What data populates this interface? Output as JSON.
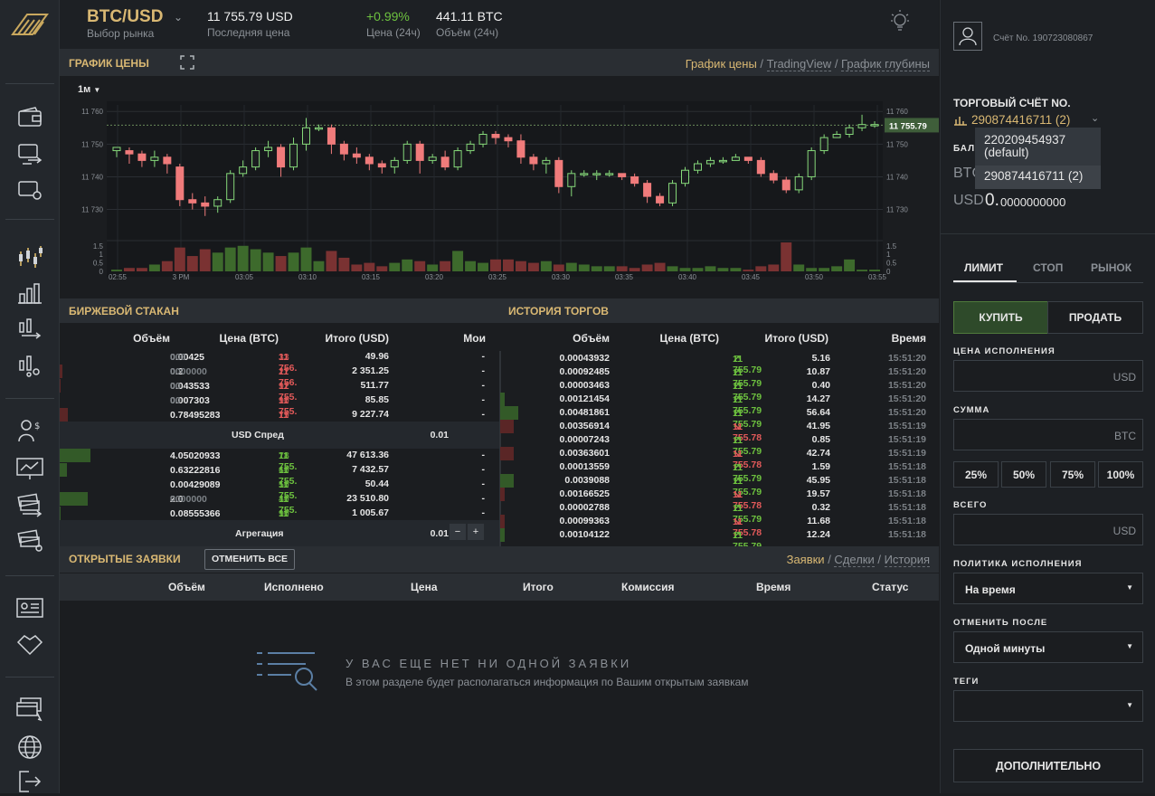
{
  "market": {
    "pair": "BTC/USD",
    "pair_sub": "Выбор рынка",
    "last_price": "11 755.79 USD",
    "last_price_sub": "Последняя цена",
    "change": "+0.99%",
    "change_sub": "Цена (24ч)",
    "volume": "441.11 BTC",
    "volume_sub": "Объём (24ч)"
  },
  "chart_panel": {
    "title": "ГРАФИК ЦЕНЫ",
    "tab_active": "График цены",
    "tab2": "TradingView",
    "tab3": "График глубины",
    "interval": "1м",
    "current_price_tag": "11 755.79",
    "y_ticks": [
      "11 760",
      "11 750",
      "11 740",
      "11 730"
    ],
    "vol_ticks": [
      "1.5",
      "1",
      "0.5",
      "0"
    ],
    "x_ticks": [
      "02:55",
      "3 PM",
      "03:05",
      "03:10",
      "03:15",
      "03:20",
      "03:25",
      "03:30",
      "03:35",
      "03:40",
      "03:45",
      "03:50",
      "03:55"
    ]
  },
  "chart_data": {
    "type": "candlestick",
    "ylim": [
      11726,
      11762
    ],
    "candles": [
      [
        11748,
        11749,
        11746,
        11748
      ],
      [
        11748,
        11747,
        11744,
        11749
      ],
      [
        11747,
        11745,
        11743,
        11748
      ],
      [
        11745,
        11746,
        11743,
        11748
      ],
      [
        11746,
        11744,
        11741,
        11747
      ],
      [
        11743,
        11733,
        11731,
        11744
      ],
      [
        11733,
        11732,
        11730,
        11735
      ],
      [
        11732,
        11731,
        11728,
        11734
      ],
      [
        11731,
        11733,
        11729,
        11734
      ],
      [
        11733,
        11741,
        11732,
        11742
      ],
      [
        11741,
        11743,
        11740,
        11745
      ],
      [
        11743,
        11748,
        11742,
        11749
      ],
      [
        11748,
        11749,
        11746,
        11751
      ],
      [
        11749,
        11743,
        11740,
        11750
      ],
      [
        11743,
        11750,
        11742,
        11752
      ],
      [
        11750,
        11755,
        11748,
        11758
      ],
      [
        11755,
        11755,
        11754,
        11756
      ],
      [
        11755,
        11750,
        11747,
        11756
      ],
      [
        11750,
        11747,
        11745,
        11751
      ],
      [
        11747,
        11746,
        11744,
        11749
      ],
      [
        11746,
        11744,
        11742,
        11747
      ],
      [
        11744,
        11743,
        11741,
        11745
      ],
      [
        11743,
        11745,
        11741,
        11746
      ],
      [
        11745,
        11750,
        11744,
        11751
      ],
      [
        11750,
        11745,
        11741,
        11751
      ],
      [
        11745,
        11746,
        11744,
        11747
      ],
      [
        11746,
        11743,
        11742,
        11748
      ],
      [
        11743,
        11748,
        11742,
        11749
      ],
      [
        11748,
        11750,
        11747,
        11751
      ],
      [
        11750,
        11753,
        11749,
        11754
      ],
      [
        11753,
        11752,
        11750,
        11754
      ],
      [
        11752,
        11751,
        11749,
        11753
      ],
      [
        11751,
        11746,
        11744,
        11753
      ],
      [
        11746,
        11744,
        11742,
        11747
      ],
      [
        11744,
        11745,
        11741,
        11746
      ],
      [
        11745,
        11737,
        11735,
        11746
      ],
      [
        11737,
        11741,
        11734,
        11742
      ],
      [
        11741,
        11741,
        11740,
        11742
      ],
      [
        11741,
        11741,
        11739,
        11742
      ],
      [
        11741,
        11741,
        11740,
        11742
      ],
      [
        11741,
        11740,
        11739,
        11741
      ],
      [
        11740,
        11738,
        11737,
        11741
      ],
      [
        11738,
        11734,
        11732,
        11739
      ],
      [
        11734,
        11732,
        11731,
        11735
      ],
      [
        11732,
        11738,
        11731,
        11739
      ],
      [
        11738,
        11742,
        11737,
        11743
      ],
      [
        11742,
        11744,
        11741,
        11745
      ],
      [
        11744,
        11745,
        11743,
        11746
      ],
      [
        11745,
        11745,
        11744,
        11746
      ],
      [
        11745,
        11746,
        11745,
        11747
      ],
      [
        11746,
        11745,
        11744,
        11746
      ],
      [
        11745,
        11741,
        11740,
        11746
      ],
      [
        11741,
        11739,
        11738,
        11742
      ],
      [
        11739,
        11736,
        11735,
        11740
      ],
      [
        11736,
        11740,
        11735,
        11741
      ],
      [
        11740,
        11748,
        11739,
        11749
      ],
      [
        11748,
        11752,
        11747,
        11753
      ],
      [
        11752,
        11753,
        11752,
        11754
      ],
      [
        11753,
        11755,
        11752,
        11756
      ],
      [
        11755,
        11756,
        11754,
        11759
      ],
      [
        11756,
        11756,
        11755,
        11757
      ]
    ],
    "volumes": [
      0.1,
      0.2,
      0.2,
      0.4,
      0.6,
      1.4,
      0.9,
      1.3,
      1.1,
      1.4,
      1.5,
      1.3,
      1.1,
      0.9,
      1.1,
      1.4,
      0.6,
      1.2,
      0.8,
      0.4,
      0.5,
      0.3,
      0.5,
      0.7,
      0.6,
      0.4,
      0.6,
      1.2,
      0.6,
      0.5,
      0.7,
      0.7,
      0.6,
      0.5,
      0.6,
      0.4,
      0.5,
      0.4,
      0.3,
      0.3,
      0.3,
      0.2,
      0.4,
      0.5,
      0.3,
      0.2,
      0.2,
      0.3,
      0.2,
      0.2,
      0.1,
      0.3,
      0.4,
      1.7,
      0.4,
      0.2,
      0.2,
      0.3,
      0.7,
      0.1,
      0.1
    ],
    "vol_ylim": [
      0,
      1.7
    ]
  },
  "orderbook": {
    "title": "БИРЖЕВОЙ СТАКАН",
    "cols": [
      "Объём",
      "Цена (BTC)",
      "Итого (USD)",
      "Мои"
    ],
    "asks": [
      {
        "vol": "0.00425",
        "vol_dim": "000",
        "price": "11 756.",
        "price_dim": "33",
        "total": "49.96",
        "mine": "-",
        "depth": 0.0
      },
      {
        "vol": "0.2",
        "vol_dim": "0000000",
        "price": "11 756.",
        "price_dim": "27",
        "total": "2 351.25",
        "mine": "-",
        "depth": 0.02
      },
      {
        "vol": "0.043533",
        "vol_dim": "00",
        "price": "11 755.",
        "price_dim": "92",
        "total": "511.77",
        "mine": "-",
        "depth": 0.01
      },
      {
        "vol": "0.007303",
        "vol_dim": "00",
        "price": "11 755.",
        "price_dim": "90",
        "total": "85.85",
        "mine": "-",
        "depth": 0.0
      },
      {
        "vol": "0.78495283",
        "vol_dim": "",
        "price": "11 755.",
        "price_dim": "79",
        "total": "9 227.74",
        "mine": "-",
        "depth": 0.07
      }
    ],
    "spread_label": "USD Спред",
    "spread": "0.01",
    "bids": [
      {
        "vol": "4.05020933",
        "vol_dim": "",
        "price": "11 755.",
        "price_dim": "78",
        "total": "47 613.36",
        "mine": "-",
        "depth": 0.26
      },
      {
        "vol": "0.63222816",
        "vol_dim": "",
        "price": "11 755.",
        "price_dim": "60",
        "total": "7 432.57",
        "mine": "-",
        "depth": 0.06
      },
      {
        "vol": "0.00429089",
        "vol_dim": "",
        "price": "11 755.",
        "price_dim": "50",
        "total": "50.44",
        "mine": "-",
        "depth": 0.0
      },
      {
        "vol": "2.0",
        "vol_dim": "0000000",
        "price": "11 755.",
        "price_dim": "40",
        "total": "23 510.80",
        "mine": "-",
        "depth": 0.24
      },
      {
        "vol": "0.08555366",
        "vol_dim": "",
        "price": "11 754.",
        "price_dim": "90",
        "total": "1 005.67",
        "mine": "-",
        "depth": 0.01
      }
    ],
    "aggregation_label": "Агрегация",
    "aggregation": "0.01",
    "minus": "−",
    "plus": "+"
  },
  "trades": {
    "title": "ИСТОРИЯ ТОРГОВ",
    "cols": [
      "Объём",
      "Цена (BTC)",
      "Итого (USD)",
      "Время"
    ],
    "rows": [
      {
        "vol": "0.00043932",
        "price": "11 755.79",
        "dir": "up",
        "total": "5.16",
        "time": "15:51:20",
        "depth": 0.0
      },
      {
        "vol": "0.00092485",
        "price": "11 755.79",
        "dir": "up",
        "total": "10.87",
        "time": "15:51:20",
        "depth": 0.0
      },
      {
        "vol": "0.00003463",
        "price": "11 755.79",
        "dir": "up",
        "total": "0.40",
        "time": "15:51:20",
        "depth": 0.0
      },
      {
        "vol": "0.00121454",
        "price": "11 755.79",
        "dir": "up",
        "total": "14.27",
        "time": "15:51:20",
        "depth": 0.01
      },
      {
        "vol": "0.00481861",
        "price": "11 755.79",
        "dir": "up",
        "total": "56.64",
        "time": "15:51:20",
        "depth": 0.04
      },
      {
        "vol": "0.00356914",
        "price": "11 755.78",
        "dir": "down",
        "total": "41.95",
        "time": "15:51:19",
        "depth": 0.03
      },
      {
        "vol": "0.00007243",
        "price": "11 755.79",
        "dir": "up",
        "total": "0.85",
        "time": "15:51:19",
        "depth": 0.0
      },
      {
        "vol": "0.00363601",
        "price": "11 755.78",
        "dir": "down",
        "total": "42.74",
        "time": "15:51:19",
        "depth": 0.03
      },
      {
        "vol": "0.00013559",
        "price": "11 755.79",
        "dir": "up",
        "total": "1.59",
        "time": "15:51:18",
        "depth": 0.0
      },
      {
        "vol": "0.0039088",
        "price": "11 755.79",
        "dir": "up",
        "total": "45.95",
        "time": "15:51:18",
        "depth": 0.03
      },
      {
        "vol": "0.00166525",
        "price": "11 755.78",
        "dir": "down",
        "total": "19.57",
        "time": "15:51:18",
        "depth": 0.01
      },
      {
        "vol": "0.00002788",
        "price": "11 755.79",
        "dir": "up",
        "total": "0.32",
        "time": "15:51:18",
        "depth": 0.0
      },
      {
        "vol": "0.00099363",
        "price": "11 755.78",
        "dir": "down",
        "total": "11.68",
        "time": "15:51:18",
        "depth": 0.01
      },
      {
        "vol": "0.00104122",
        "price": "11 755.79",
        "dir": "up",
        "total": "12.24",
        "time": "15:51:18",
        "depth": 0.01
      }
    ]
  },
  "orders": {
    "title": "ОТКРЫТЫЕ ЗАЯВКИ",
    "cancel_all": "ОТМЕНИТЬ ВСЕ",
    "tab_active": "Заявки",
    "tab2": "Сделки",
    "tab3": "История",
    "cols": [
      "Объём",
      "Исполнено",
      "Цена",
      "Итого",
      "Комиссия",
      "Время",
      "Статус"
    ],
    "empty_title": "У ВАС ЕЩЕ НЕТ НИ ОДНОЙ ЗАЯВКИ",
    "empty_text": "В этом разделе будет располагаться информация по Вашим открытым заявкам"
  },
  "account": {
    "account_no": "Счёт No. 190723080867",
    "trading_title": "ТОРГОВЫЙ СЧЁТ NO.",
    "selected": "290874416711 (2)",
    "dropdown": [
      {
        "line1": "220209454937",
        "line2": "(default)"
      },
      {
        "line1": "290874416711 (2)",
        "line2": ""
      }
    ],
    "balance_label": "БАЛА",
    "btc_label": "BTC",
    "usd_label": "USD",
    "usd_balance_int": "0.",
    "usd_balance_dec": "0000000000"
  },
  "order_form": {
    "tab_limit": "ЛИМИТ",
    "tab_stop": "СТОП",
    "tab_market": "РЫНОК",
    "buy": "КУПИТЬ",
    "sell": "ПРОДАТЬ",
    "price_label": "ЦЕНА ИСПОЛНЕНИЯ",
    "price_unit": "USD",
    "amount_label": "СУММА",
    "amount_unit": "BTC",
    "pct": [
      "25%",
      "50%",
      "75%",
      "100%"
    ],
    "total_label": "ВСЕГО",
    "total_unit": "USD",
    "policy_label": "ПОЛИТИКА ИСПОЛНЕНИЯ",
    "policy_value": "На время",
    "cancel_label": "ОТМЕНИТЬ ПОСЛЕ",
    "cancel_value": "Одной минуты",
    "tags_label": "ТЕГИ",
    "tags_value": "",
    "more": "ДОПОЛНИТЕЛЬНО"
  },
  "colors": {
    "gold": "#d9b873",
    "green": "#6dc13f",
    "red": "#e35a5a",
    "candle_up": "#86d97a",
    "candle_down": "#f07b7b",
    "vol_up": "#3d6a2c",
    "vol_down": "#7a3232"
  }
}
